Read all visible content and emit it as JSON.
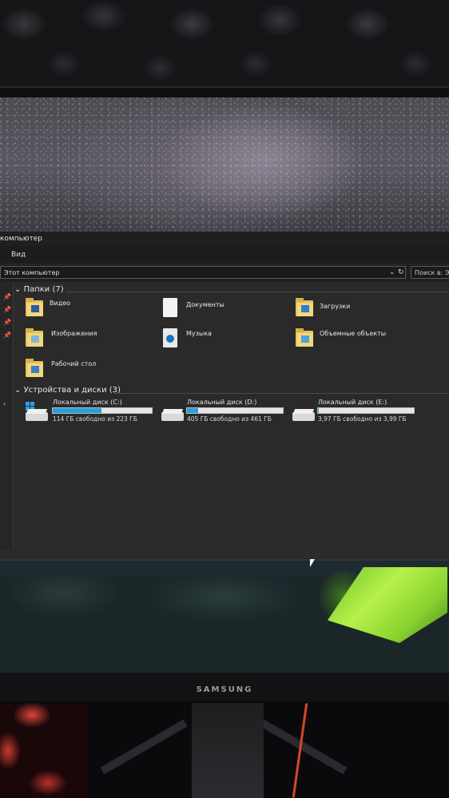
{
  "window": {
    "title": "компьютер",
    "ribbon_tab": "Вид",
    "address": "Этот компьютер",
    "address_dropdown_icon": "chevron-down-icon",
    "refresh_icon": "refresh-icon",
    "search_placeholder": "Поиск в: Эт"
  },
  "folders": {
    "header": "Папки (7)",
    "items": [
      {
        "label": "Видео",
        "icon": "video-folder-icon"
      },
      {
        "label": "Документы",
        "icon": "documents-icon"
      },
      {
        "label": "Загрузки",
        "icon": "downloads-folder-icon"
      },
      {
        "label": "Изображения",
        "icon": "pictures-folder-icon"
      },
      {
        "label": "Музыка",
        "icon": "music-icon"
      },
      {
        "label": "Объемные объекты",
        "icon": "3d-objects-folder-icon"
      },
      {
        "label": "Рабочий стол",
        "icon": "desktop-folder-icon"
      }
    ]
  },
  "drives": {
    "header": "Устройства и диски (3)",
    "items": [
      {
        "name": "Локальный диск (C:)",
        "free": "114 ГБ свободно из 223 ГБ",
        "used_fraction": 0.49
      },
      {
        "name": "Локальный диск (D:)",
        "free": "405 ГБ свободно из 461 ГБ",
        "used_fraction": 0.12
      },
      {
        "name": "Локальный диск (E:)",
        "free": "3,97 ГБ свободно из 3,99 ГБ",
        "used_fraction": 0.01
      }
    ]
  },
  "monitor": {
    "brand": "SAMSUNG"
  },
  "colors": {
    "drive_fill": "#26a0da",
    "folder": "#f4d77a"
  }
}
